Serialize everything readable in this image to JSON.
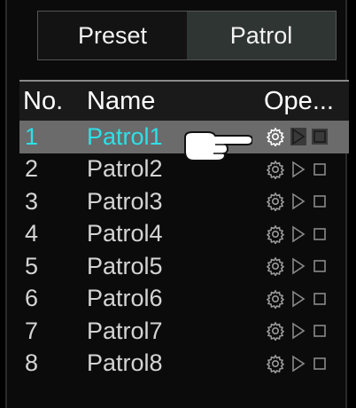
{
  "tabs": [
    {
      "label": "Preset",
      "active": false
    },
    {
      "label": "Patrol",
      "active": true
    }
  ],
  "table": {
    "headers": {
      "no": "No.",
      "name": "Name",
      "ope": "Ope..."
    },
    "rows": [
      {
        "no": "1",
        "name": "Patrol1",
        "selected": true
      },
      {
        "no": "2",
        "name": "Patrol2",
        "selected": false
      },
      {
        "no": "3",
        "name": "Patrol3",
        "selected": false
      },
      {
        "no": "4",
        "name": "Patrol4",
        "selected": false
      },
      {
        "no": "5",
        "name": "Patrol5",
        "selected": false
      },
      {
        "no": "6",
        "name": "Patrol6",
        "selected": false
      },
      {
        "no": "7",
        "name": "Patrol7",
        "selected": false
      },
      {
        "no": "8",
        "name": "Patrol8",
        "selected": false
      }
    ]
  },
  "icons": {
    "settings": "gear-icon",
    "play": "play-icon",
    "stop": "stop-icon",
    "pointer": "pointing-hand-icon"
  },
  "colors": {
    "selected_text": "#2de0e8",
    "selected_row": "#6b6b6b",
    "text": "#d4d4d4"
  }
}
